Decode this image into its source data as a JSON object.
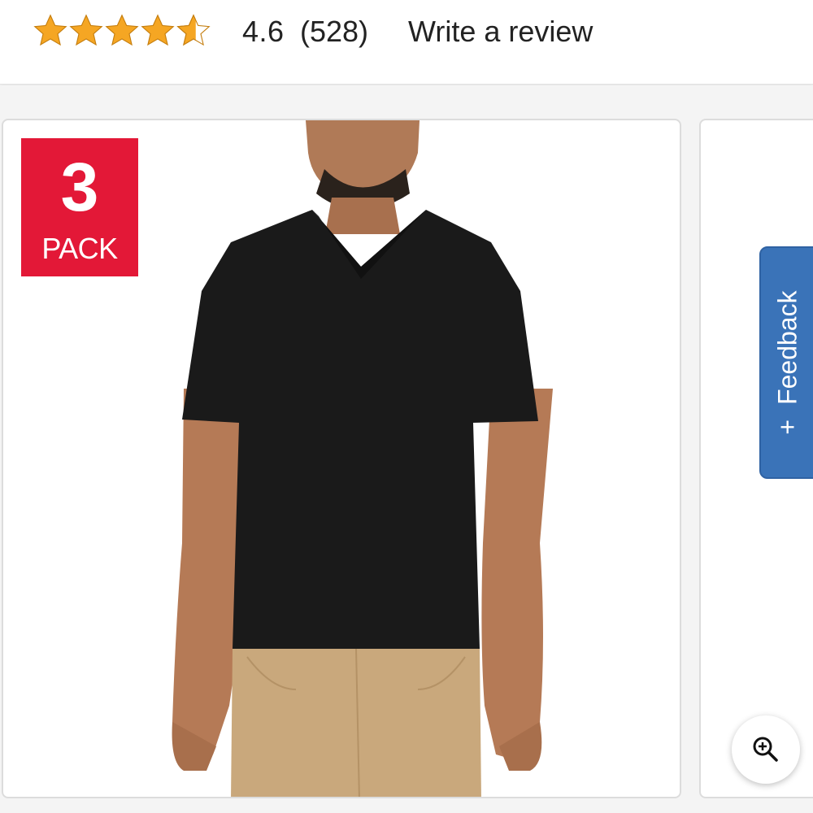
{
  "rating": {
    "stars": 4.6,
    "value_text": "4.6",
    "count_text": "(528)",
    "write_review": "Write a review",
    "star_color": "#f5a623"
  },
  "badge": {
    "number": "3",
    "word": "PACK",
    "color": "#e31837"
  },
  "feedback": {
    "plus": "+",
    "label": "Feedback",
    "color": "#3a73b8"
  },
  "zoom": {
    "icon": "zoom-in-icon"
  }
}
